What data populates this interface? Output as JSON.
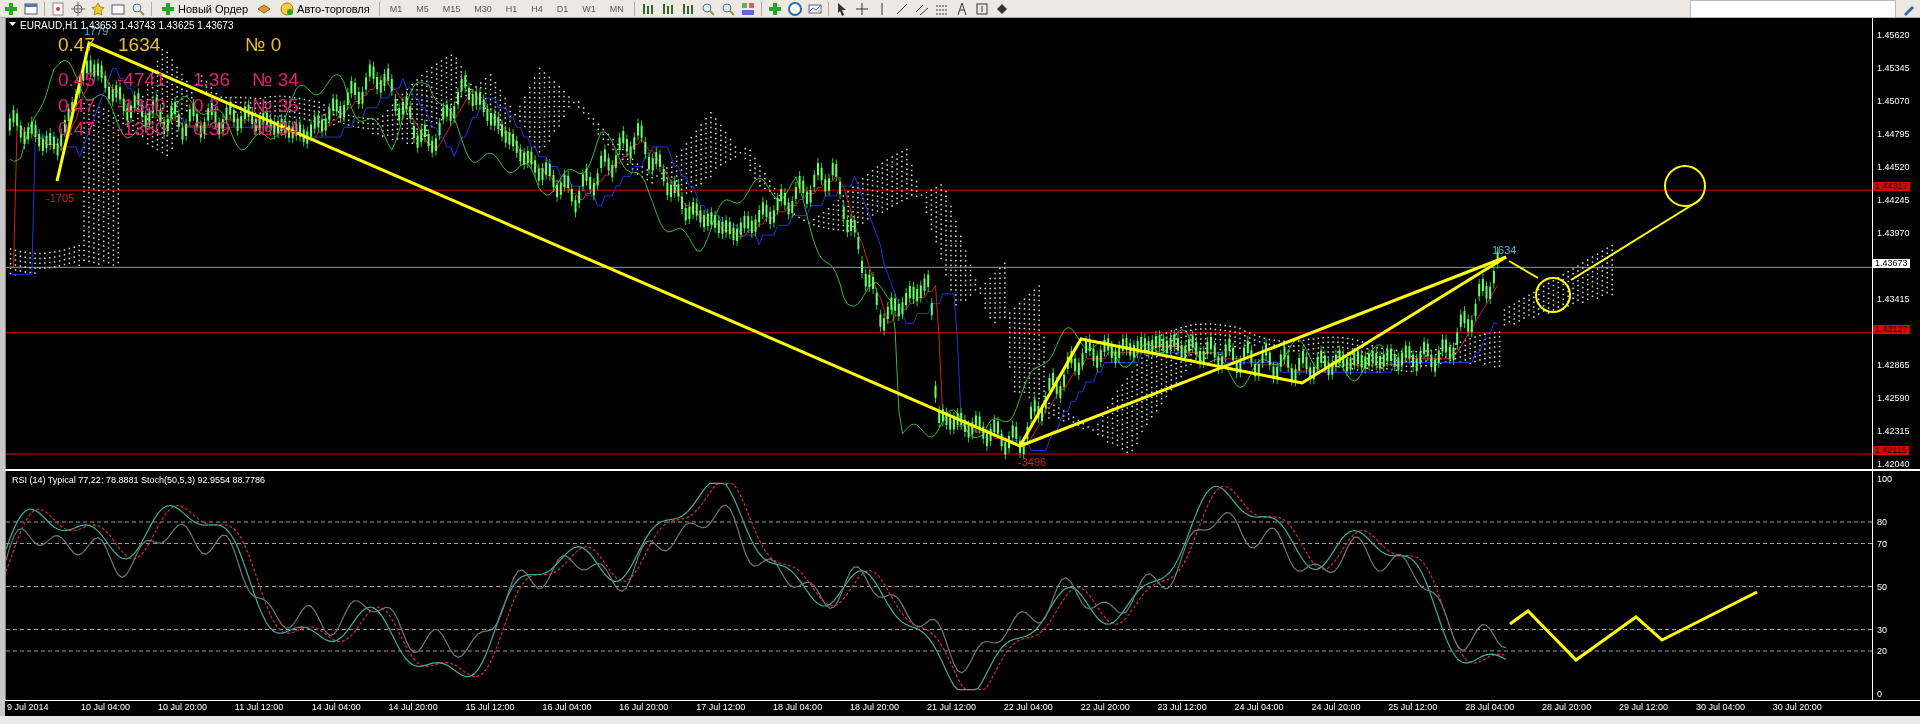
{
  "toolbar": {
    "buttons": [
      {
        "label": "Новый Ордер",
        "kind": "order"
      },
      {
        "label": "Авто-торговля",
        "kind": "auto"
      }
    ],
    "timeframes": [
      "M1",
      "M5",
      "M15",
      "M30",
      "H1",
      "H4",
      "D1",
      "W1",
      "MN"
    ]
  },
  "chart": {
    "title": "EURAUD,H1  1.43653 1.43743 1.43625 1.43673",
    "stats": [
      {
        "color": "#e8c020",
        "cells": [
          "0.47",
          "1634",
          "№ 0"
        ]
      },
      {
        "color": "#e0207a",
        "cells": [
          "0.45",
          "-4741",
          "1.36",
          "№ 34"
        ]
      },
      {
        "color": "#e0207a",
        "cells": [
          "0.47",
          "-1360",
          "0.3",
          "№ 35"
        ]
      },
      {
        "color": "#e0207a",
        "cells": [
          "0.47",
          "-1360",
          "0.39",
          "№ 34"
        ]
      }
    ],
    "zigzag_labels": [
      {
        "text": "1779",
        "kind": "high"
      },
      {
        "text": "-1705",
        "kind": "low"
      },
      {
        "text": "-3496",
        "kind": "low"
      },
      {
        "text": "1634",
        "kind": "high"
      }
    ],
    "price_ticks": [
      "1.45620",
      "1.45345",
      "1.45070",
      "1.44795",
      "1.44520",
      "1.44245",
      "1.43970",
      "1.43415",
      "1.42865",
      "1.42590",
      "1.42315",
      "1.42040"
    ],
    "levels": [
      {
        "price": "1.44317",
        "color": "#e00000"
      },
      {
        "price": "1.43673",
        "color": "#ffffff"
      },
      {
        "price": "1.43127",
        "color": "#e00000"
      },
      {
        "price": "1.42115",
        "color": "#e00000"
      }
    ]
  },
  "oscillator": {
    "label": "RSI (14) Typical 77,22: 78.8881 Stoch(50,5,3) 92.9554 88.7786",
    "ticks": [
      "100",
      "80",
      "70",
      "50",
      "30",
      "20",
      "0"
    ]
  },
  "time_axis": [
    "9 Jul 2014",
    "10 Jul 04:00",
    "10 Jul 20:00",
    "11 Jul 12:00",
    "14 Jul 04:00",
    "14 Jul 20:00",
    "15 Jul 12:00",
    "16 Jul 04:00",
    "16 Jul 20:00",
    "17 Jul 12:00",
    "18 Jul 04:00",
    "18 Jul 20:00",
    "21 Jul 12:00",
    "22 Jul 04:00",
    "22 Jul 20:00",
    "23 Jul 12:00",
    "24 Jul 04:00",
    "24 Jul 20:00",
    "25 Jul 12:00",
    "28 Jul 04:00",
    "28 Jul 20:00",
    "29 Jul 12:00",
    "30 Jul 04:00",
    "30 Jul 20:00"
  ]
}
